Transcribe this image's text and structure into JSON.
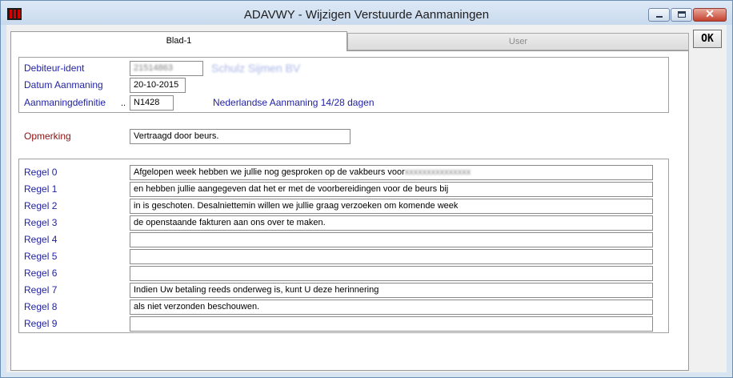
{
  "window": {
    "title": "ADAVWY - Wijzigen Verstuurde Aanmaningen"
  },
  "tabs": [
    {
      "label": "Blad-1",
      "active": true
    },
    {
      "label": "User",
      "active": false
    }
  ],
  "ok_button": {
    "label": "OK"
  },
  "header": {
    "debiteur_label": "Debiteur-ident",
    "debiteur_value": "21514863",
    "debiteur_name": "Schulz Sijmen BV",
    "datum_label": "Datum Aanmaning",
    "datum_value": "20-10-2015",
    "definitie_label": "Aanmaningdefinitie",
    "definitie_dots": "..",
    "definitie_value": "N1428",
    "definitie_desc": "Nederlandse Aanmaning 14/28 dagen"
  },
  "opmerking": {
    "label": "Opmerking",
    "value": "Vertraagd door beurs."
  },
  "regels": [
    {
      "label": "Regel 0",
      "value": "Afgelopen week hebben we jullie nog gesproken op de vakbeurs voor",
      "redacted": "xxxxxxxxxxxxxxx"
    },
    {
      "label": "Regel 1",
      "value": "en hebben jullie aangegeven dat het er met de voorbereidingen voor de beurs bij"
    },
    {
      "label": "Regel 2",
      "value": "in is geschoten. Desalniettemin willen we jullie graag verzoeken om komende week"
    },
    {
      "label": "Regel 3",
      "value": "de openstaande fakturen aan ons over te maken."
    },
    {
      "label": "Regel 4",
      "value": ""
    },
    {
      "label": "Regel 5",
      "value": ""
    },
    {
      "label": "Regel 6",
      "value": ""
    },
    {
      "label": "Regel 7",
      "value": "Indien Uw betaling reeds onderweg is, kunt U deze herinnering"
    },
    {
      "label": "Regel 8",
      "value": "als niet verzonden beschouwen."
    },
    {
      "label": "Regel 9",
      "value": ""
    }
  ],
  "colors": {
    "label_blue": "#1f1fa3",
    "label_red": "#8b1010",
    "close_red": "#c4402f"
  }
}
